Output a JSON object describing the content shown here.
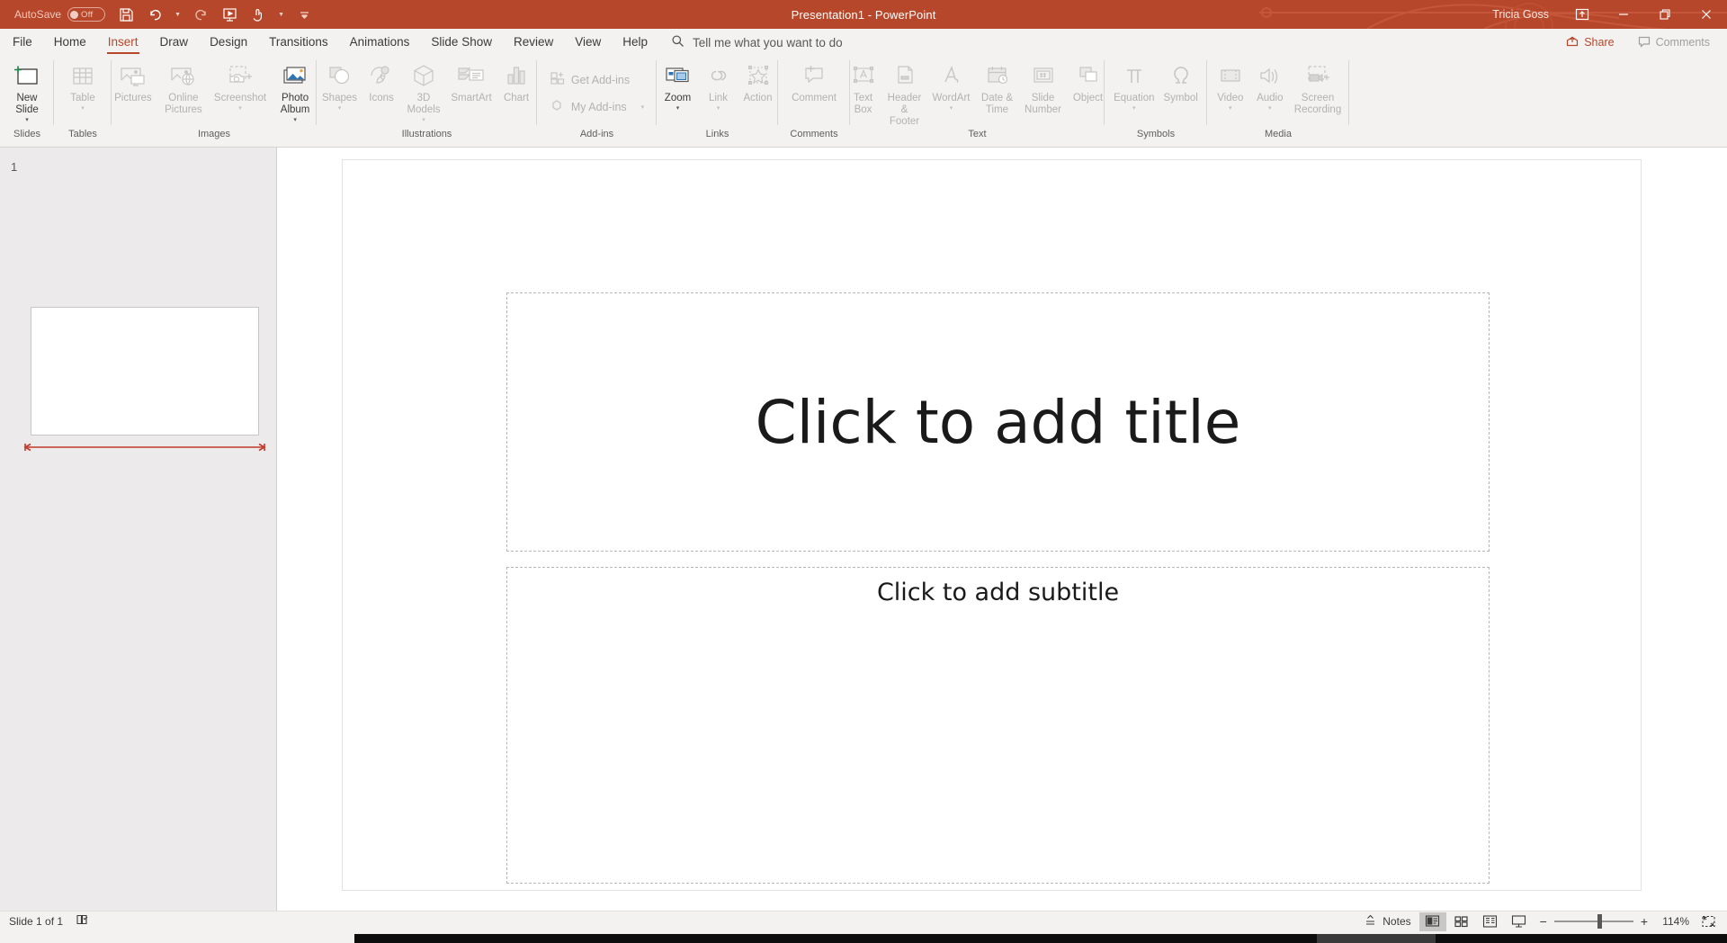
{
  "titlebar": {
    "autosave_label": "AutoSave",
    "autosave_state": "Off",
    "quick_access": [
      {
        "name": "save-button",
        "icon": "save-icon"
      },
      {
        "name": "undo-button",
        "icon": "undo-icon"
      },
      {
        "name": "redo-button",
        "icon": "redo-icon"
      },
      {
        "name": "start-from-beginning-button",
        "icon": "start-slideshow-icon"
      },
      {
        "name": "touch-mouse-mode-button",
        "icon": "touch-mode-icon"
      },
      {
        "name": "customize-quick-access-toolbar-button",
        "icon": "chevron-down-icon"
      }
    ],
    "window_title": "Presentation1  -  PowerPoint",
    "account_name": "Tricia Goss",
    "ribbon_display_options": "ribbon-display-options-icon",
    "minimize": "minimize-icon",
    "restore": "restore-icon",
    "close": "close-icon",
    "accent_color": "#b7472a"
  },
  "menubar": {
    "tabs": [
      {
        "label": "File",
        "active": false
      },
      {
        "label": "Home",
        "active": false
      },
      {
        "label": "Insert",
        "active": true
      },
      {
        "label": "Draw",
        "active": false
      },
      {
        "label": "Design",
        "active": false
      },
      {
        "label": "Transitions",
        "active": false
      },
      {
        "label": "Animations",
        "active": false
      },
      {
        "label": "Slide Show",
        "active": false
      },
      {
        "label": "Review",
        "active": false
      },
      {
        "label": "View",
        "active": false
      },
      {
        "label": "Help",
        "active": false
      }
    ],
    "tellme_placeholder": "Tell me what you want to do",
    "share_label": "Share",
    "comments_label": "Comments"
  },
  "ribbon": {
    "groups": [
      {
        "label": "Slides",
        "items": [
          {
            "label": "New\nSlide",
            "icon": "new-slide-icon",
            "disabled": false,
            "caret": true
          }
        ]
      },
      {
        "label": "Tables",
        "items": [
          {
            "label": "Table",
            "icon": "table-icon",
            "disabled": true,
            "caret": true
          }
        ]
      },
      {
        "label": "Images",
        "items": [
          {
            "label": "Pictures",
            "icon": "pictures-icon",
            "disabled": true,
            "caret": false
          },
          {
            "label": "Online\nPictures",
            "icon": "online-pictures-icon",
            "disabled": true,
            "caret": false
          },
          {
            "label": "Screenshot",
            "icon": "screenshot-icon",
            "disabled": true,
            "caret": true
          },
          {
            "label": "Photo\nAlbum",
            "icon": "photo-album-icon",
            "disabled": false,
            "caret": true
          }
        ]
      },
      {
        "label": "Illustrations",
        "items": [
          {
            "label": "Shapes",
            "icon": "shapes-icon",
            "disabled": true,
            "caret": true
          },
          {
            "label": "Icons",
            "icon": "icons-icon",
            "disabled": true,
            "caret": false
          },
          {
            "label": "3D\nModels",
            "icon": "3d-models-icon",
            "disabled": true,
            "caret": true
          },
          {
            "label": "SmartArt",
            "icon": "smartart-icon",
            "disabled": true,
            "caret": false
          },
          {
            "label": "Chart",
            "icon": "chart-icon",
            "disabled": true,
            "caret": false
          }
        ]
      },
      {
        "label": "Add-ins",
        "items": [
          {
            "label": "Get Add-ins",
            "icon": "get-addins-icon",
            "disabled": true,
            "caret": false
          },
          {
            "label": "My Add-ins",
            "icon": "my-addins-icon",
            "disabled": true,
            "caret": true
          }
        ]
      },
      {
        "label": "Links",
        "items": [
          {
            "label": "Zoom",
            "icon": "zoom-insert-icon",
            "disabled": false,
            "caret": true
          },
          {
            "label": "Link",
            "icon": "link-icon",
            "disabled": true,
            "caret": true
          },
          {
            "label": "Action",
            "icon": "action-icon",
            "disabled": true,
            "caret": false
          }
        ]
      },
      {
        "label": "Comments",
        "items": [
          {
            "label": "Comment",
            "icon": "comment-icon",
            "disabled": true,
            "caret": false
          }
        ]
      },
      {
        "label": "Text",
        "items": [
          {
            "label": "Text\nBox",
            "icon": "text-box-icon",
            "disabled": true,
            "caret": false
          },
          {
            "label": "Header\n& Footer",
            "icon": "header-footer-icon",
            "disabled": true,
            "caret": false
          },
          {
            "label": "WordArt",
            "icon": "wordart-icon",
            "disabled": true,
            "caret": true
          },
          {
            "label": "Date &\nTime",
            "icon": "date-time-icon",
            "disabled": true,
            "caret": false
          },
          {
            "label": "Slide\nNumber",
            "icon": "slide-number-icon",
            "disabled": true,
            "caret": false
          },
          {
            "label": "Object",
            "icon": "object-icon",
            "disabled": true,
            "caret": false
          }
        ]
      },
      {
        "label": "Symbols",
        "items": [
          {
            "label": "Equation",
            "icon": "equation-icon",
            "disabled": true,
            "caret": true
          },
          {
            "label": "Symbol",
            "icon": "symbol-icon",
            "disabled": true,
            "caret": false
          }
        ]
      },
      {
        "label": "Media",
        "items": [
          {
            "label": "Video",
            "icon": "video-icon",
            "disabled": true,
            "caret": true
          },
          {
            "label": "Audio",
            "icon": "audio-icon",
            "disabled": true,
            "caret": true
          },
          {
            "label": "Screen\nRecording",
            "icon": "screen-recording-icon",
            "disabled": true,
            "caret": false
          }
        ]
      }
    ]
  },
  "thumbnail_pane": {
    "slides": [
      {
        "number": "1",
        "selected": true
      }
    ],
    "annotation": {
      "name": "width-arrow-annotation",
      "color": "#c0392b"
    }
  },
  "slide": {
    "title_placeholder": "Click to add title",
    "subtitle_placeholder": "Click to add subtitle"
  },
  "statusbar": {
    "slide_indicator": "Slide 1 of 1",
    "accessibility_icon": "accessibility-checker-icon",
    "notes_label": "Notes",
    "views": [
      {
        "name": "normal-view-button",
        "icon": "normal-view-icon",
        "active": true
      },
      {
        "name": "slide-sorter-view-button",
        "icon": "slide-sorter-icon",
        "active": false
      },
      {
        "name": "reading-view-button",
        "icon": "reading-view-icon",
        "active": false
      },
      {
        "name": "slide-show-button",
        "icon": "slide-show-icon",
        "active": false
      }
    ],
    "zoom_out": "−",
    "zoom_in": "+",
    "zoom_level": "114%",
    "fit_slide_icon": "fit-to-window-icon"
  }
}
